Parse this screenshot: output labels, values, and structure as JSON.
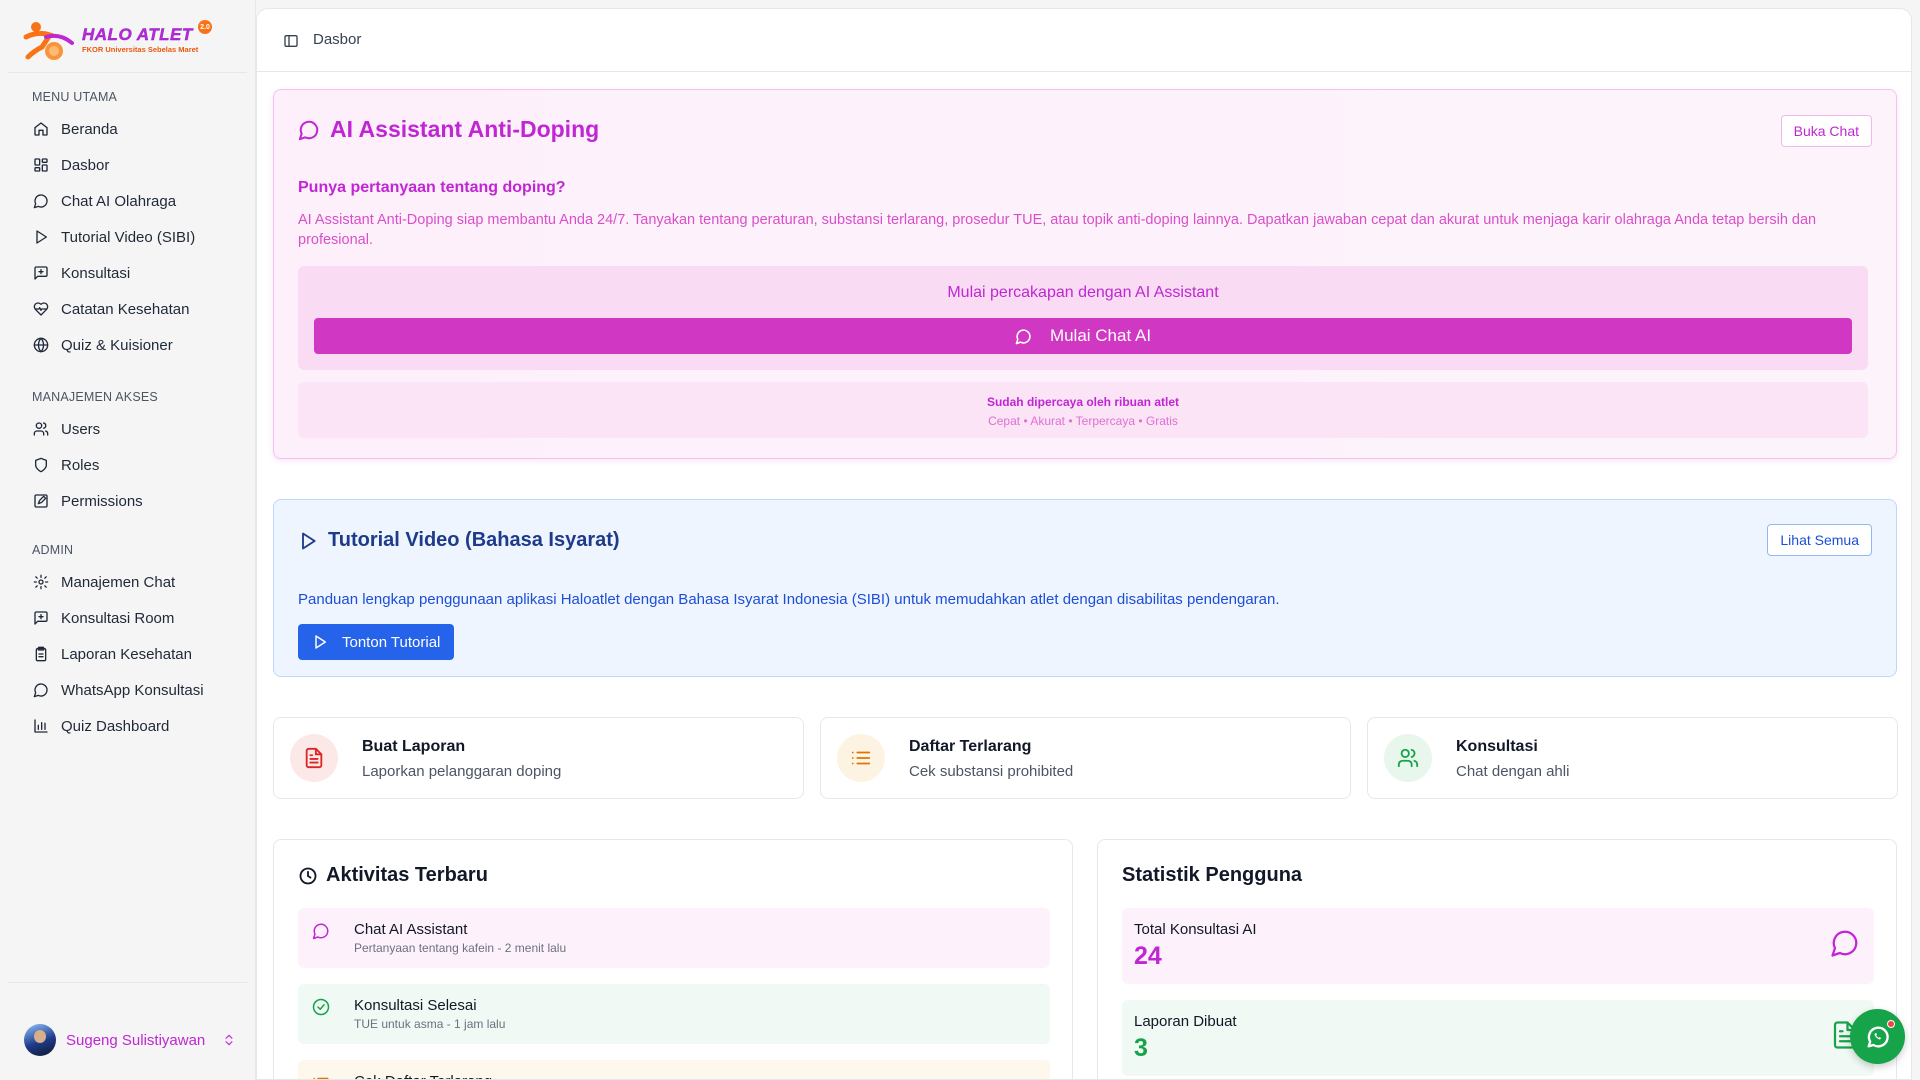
{
  "brand": {
    "title": "HALO ATLET",
    "subtitle": "FKOR Universitas Sebelas Maret",
    "badge": "2.0"
  },
  "sidebar": {
    "sections": [
      {
        "label": "MENU UTAMA",
        "items": [
          {
            "label": "Beranda",
            "icon": "home-icon"
          },
          {
            "label": "Dasbor",
            "icon": "dashboard-icon"
          },
          {
            "label": "Chat AI Olahraga",
            "icon": "chat-icon"
          },
          {
            "label": "Tutorial Video (SIBI)",
            "icon": "play-icon"
          },
          {
            "label": "Konsultasi",
            "icon": "message-square-icon"
          },
          {
            "label": "Catatan Kesehatan",
            "icon": "heart-pulse-icon"
          },
          {
            "label": "Quiz & Kuisioner",
            "icon": "globe-icon"
          }
        ]
      },
      {
        "label": "MANAJEMEN AKSES",
        "items": [
          {
            "label": "Users",
            "icon": "users-icon"
          },
          {
            "label": "Roles",
            "icon": "shield-icon"
          },
          {
            "label": "Permissions",
            "icon": "edit-square-icon"
          }
        ]
      },
      {
        "label": "ADMIN",
        "items": [
          {
            "label": "Manajemen Chat",
            "icon": "gear-icon"
          },
          {
            "label": "Konsultasi Room",
            "icon": "message-square-icon"
          },
          {
            "label": "Laporan Kesehatan",
            "icon": "clipboard-icon"
          },
          {
            "label": "WhatsApp Konsultasi",
            "icon": "chat-icon"
          },
          {
            "label": "Quiz Dashboard",
            "icon": "bar-chart-icon"
          }
        ]
      }
    ],
    "user": {
      "name": "Sugeng Sulistiyawan"
    }
  },
  "topbar": {
    "breadcrumb": "Dasbor"
  },
  "ai_card": {
    "title": "AI Assistant Anti-Doping",
    "open_button": "Buka Chat",
    "question": "Punya pertanyaan tentang doping?",
    "description": "AI Assistant Anti-Doping siap membantu Anda 24/7. Tanyakan tentang peraturan, substansi terlarang, prosedur TUE, atau topik anti-doping lainnya. Dapatkan jawaban cepat dan akurat untuk menjaga karir olahraga Anda tetap bersih dan profesional.",
    "cta_text": "Mulai percakapan dengan AI Assistant",
    "start_button": "Mulai Chat AI",
    "trust_line": "Sudah dipercaya oleh ribuan atlet",
    "trust_tags": "Cepat • Akurat • Terpercaya • Gratis"
  },
  "tutorial_card": {
    "title": "Tutorial Video (Bahasa Isyarat)",
    "all_button": "Lihat Semua",
    "description": "Panduan lengkap penggunaan aplikasi Haloatlet dengan Bahasa Isyarat Indonesia (SIBI) untuk memudahkan atlet dengan disabilitas pendengaran.",
    "watch_button": "Tonton Tutorial"
  },
  "quick_actions": [
    {
      "title": "Buat Laporan",
      "subtitle": "Laporkan pelanggaran doping",
      "icon": "file-text-icon",
      "color": "#dc2626",
      "bg": "#fde8e8"
    },
    {
      "title": "Daftar Terlarang",
      "subtitle": "Cek substansi prohibited",
      "icon": "list-icon",
      "color": "#d97706",
      "bg": "#fdf3e2"
    },
    {
      "title": "Konsultasi",
      "subtitle": "Chat dengan ahli",
      "icon": "users-icon",
      "color": "#16a34a",
      "bg": "#e8f6ec"
    }
  ],
  "activity": {
    "title": "Aktivitas Terbaru",
    "items": [
      {
        "title": "Chat AI Assistant",
        "subtitle": "Pertanyaan tentang kafein - 2 menit lalu",
        "icon": "chat-icon",
        "bg": "#fdf2fb",
        "color": "#c026d3"
      },
      {
        "title": "Konsultasi Selesai",
        "subtitle": "TUE untuk asma - 1 jam lalu",
        "icon": "check-circle-icon",
        "bg": "#f0f9f3",
        "color": "#16a34a"
      },
      {
        "title": "Cek Daftar Terlarang",
        "subtitle": "",
        "icon": "list-icon",
        "bg": "#fdf7ec",
        "color": "#d97706"
      }
    ]
  },
  "stats": {
    "title": "Statistik Pengguna",
    "items": [
      {
        "label": "Total Konsultasi AI",
        "value": "24",
        "icon": "chat-icon",
        "bg": "#fdf2fb",
        "color": "#c026d3"
      },
      {
        "label": "Laporan Dibuat",
        "value": "3",
        "icon": "file-text-icon",
        "bg": "#f0f9f3",
        "color": "#16a34a"
      }
    ]
  },
  "colors": {
    "accent": "#c026d3",
    "blue": "#2563eb",
    "whatsapp": "#16a34a"
  }
}
